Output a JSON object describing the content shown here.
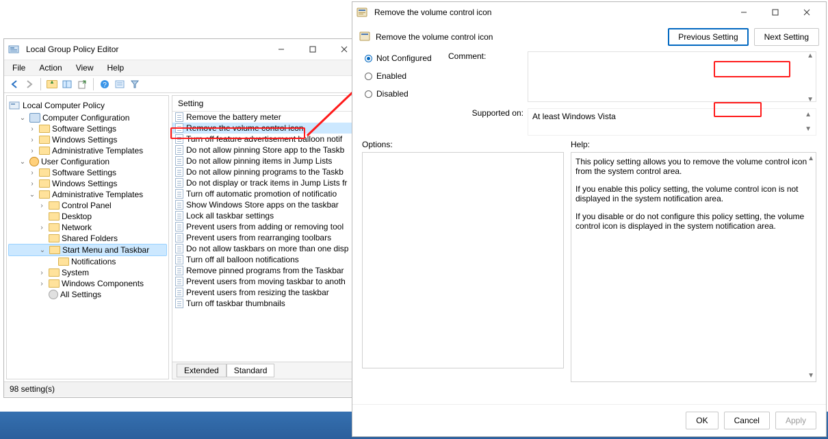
{
  "gpeditor": {
    "title": "Local Group Policy Editor",
    "menus": [
      "File",
      "Action",
      "View",
      "Help"
    ],
    "tree": {
      "root": "Local Computer Policy",
      "computer_config": "Computer Configuration",
      "cc_children": [
        "Software Settings",
        "Windows Settings",
        "Administrative Templates"
      ],
      "user_config": "User Configuration",
      "uc_children": [
        "Software Settings",
        "Windows Settings",
        "Administrative Templates"
      ],
      "adm_children": [
        "Control Panel",
        "Desktop",
        "Network",
        "Shared Folders",
        "Start Menu and Taskbar",
        "System",
        "Windows Components",
        "All Settings"
      ],
      "sm_children": [
        "Notifications"
      ]
    },
    "list": {
      "header": "Setting",
      "items": [
        "Remove the battery meter",
        "Remove the volume control icon",
        "Turn off feature advertisement balloon notif",
        "Do not allow pinning Store app to the Taskb",
        "Do not allow pinning items in Jump Lists",
        "Do not allow pinning programs to the Taskb",
        "Do not display or track items in Jump Lists fr",
        "Turn off automatic promotion of notificatio",
        "Show Windows Store apps on the taskbar",
        "Lock all taskbar settings",
        "Prevent users from adding or removing tool",
        "Prevent users from rearranging toolbars",
        "Do not allow taskbars on more than one disp",
        "Turn off all balloon notifications",
        "Remove pinned programs from the Taskbar",
        "Prevent users from moving taskbar to anoth",
        "Prevent users from resizing the taskbar",
        "Turn off taskbar thumbnails"
      ]
    },
    "tabs": [
      "Extended",
      "Standard"
    ],
    "status": "98 setting(s)"
  },
  "dialog": {
    "title": "Remove the volume control icon",
    "heading": "Remove the volume control icon",
    "prev_btn": "Previous Setting",
    "next_btn": "Next Setting",
    "radios": {
      "not_configured": "Not Configured",
      "enabled": "Enabled",
      "disabled": "Disabled"
    },
    "comment_label": "Comment:",
    "supported_label": "Supported on:",
    "supported_value": "At least Windows Vista",
    "options_label": "Options:",
    "help_label": "Help:",
    "help_text": [
      "This policy setting allows you to remove the volume control icon from the system control area.",
      "If you enable this policy setting, the volume control icon is not displayed in the system notification area.",
      "If you disable or do not configure this policy setting, the volume control icon is displayed in the system notification area."
    ],
    "ok_btn": "OK",
    "cancel_btn": "Cancel",
    "apply_btn": "Apply"
  }
}
